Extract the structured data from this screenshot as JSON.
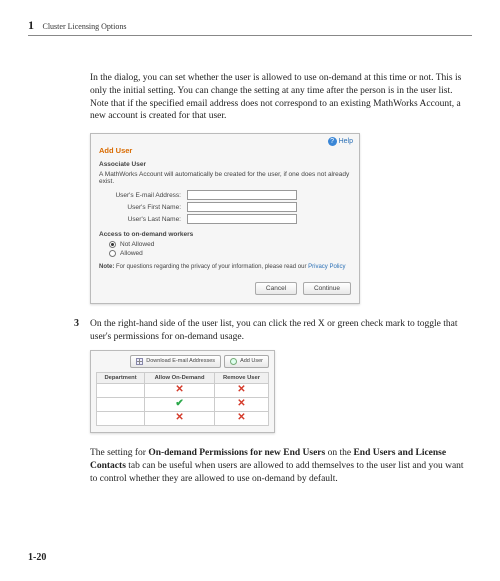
{
  "chapter": {
    "number": "1",
    "title": "Cluster Licensing Options"
  },
  "intro_para": "In the dialog, you can set whether the user is allowed to use on-demand at this time or not. This is only the initial setting. You can change the setting at any time after the person is in the user list. Note that if the specified email address does not correspond to an existing MathWorks Account, a new account is created for that user.",
  "dialog": {
    "help_label": "Help",
    "title": "Add User",
    "associate_label": "Associate User",
    "associate_desc": "A MathWorks Account will automatically be created for the user, if one does not already exist.",
    "email_label": "User's E-mail Address:",
    "first_label": "User's First Name:",
    "last_label": "User's Last Name:",
    "access_title": "Access to on-demand workers",
    "not_allowed_label": "Not Allowed",
    "allowed_label": "Allowed",
    "note_prefix": "Note:",
    "note_text": " For questions regarding the privacy of your information, please read our ",
    "note_link": "Privacy Policy",
    "cancel": "Cancel",
    "continue": "Continue"
  },
  "step3": {
    "num": "3",
    "text": "On the right-hand side of the user list, you can click the red X or green check mark to toggle that user's permissions for on-demand usage."
  },
  "user_table": {
    "download_label": "Download E-mail Addresses",
    "add_user_label": "Add User",
    "cols": {
      "dept": "Department",
      "allow": "Allow On-Demand",
      "remove": "Remove User"
    }
  },
  "closing": {
    "t1": "The setting for ",
    "b1": "On-demand Permissions for new End Users",
    "t2": " on the ",
    "b2": "End Users and License Contacts",
    "t3": " tab can be useful when users are allowed to add themselves to the user list and you want to control whether they are allowed to use on-demand by default."
  },
  "page_number": "1-20"
}
